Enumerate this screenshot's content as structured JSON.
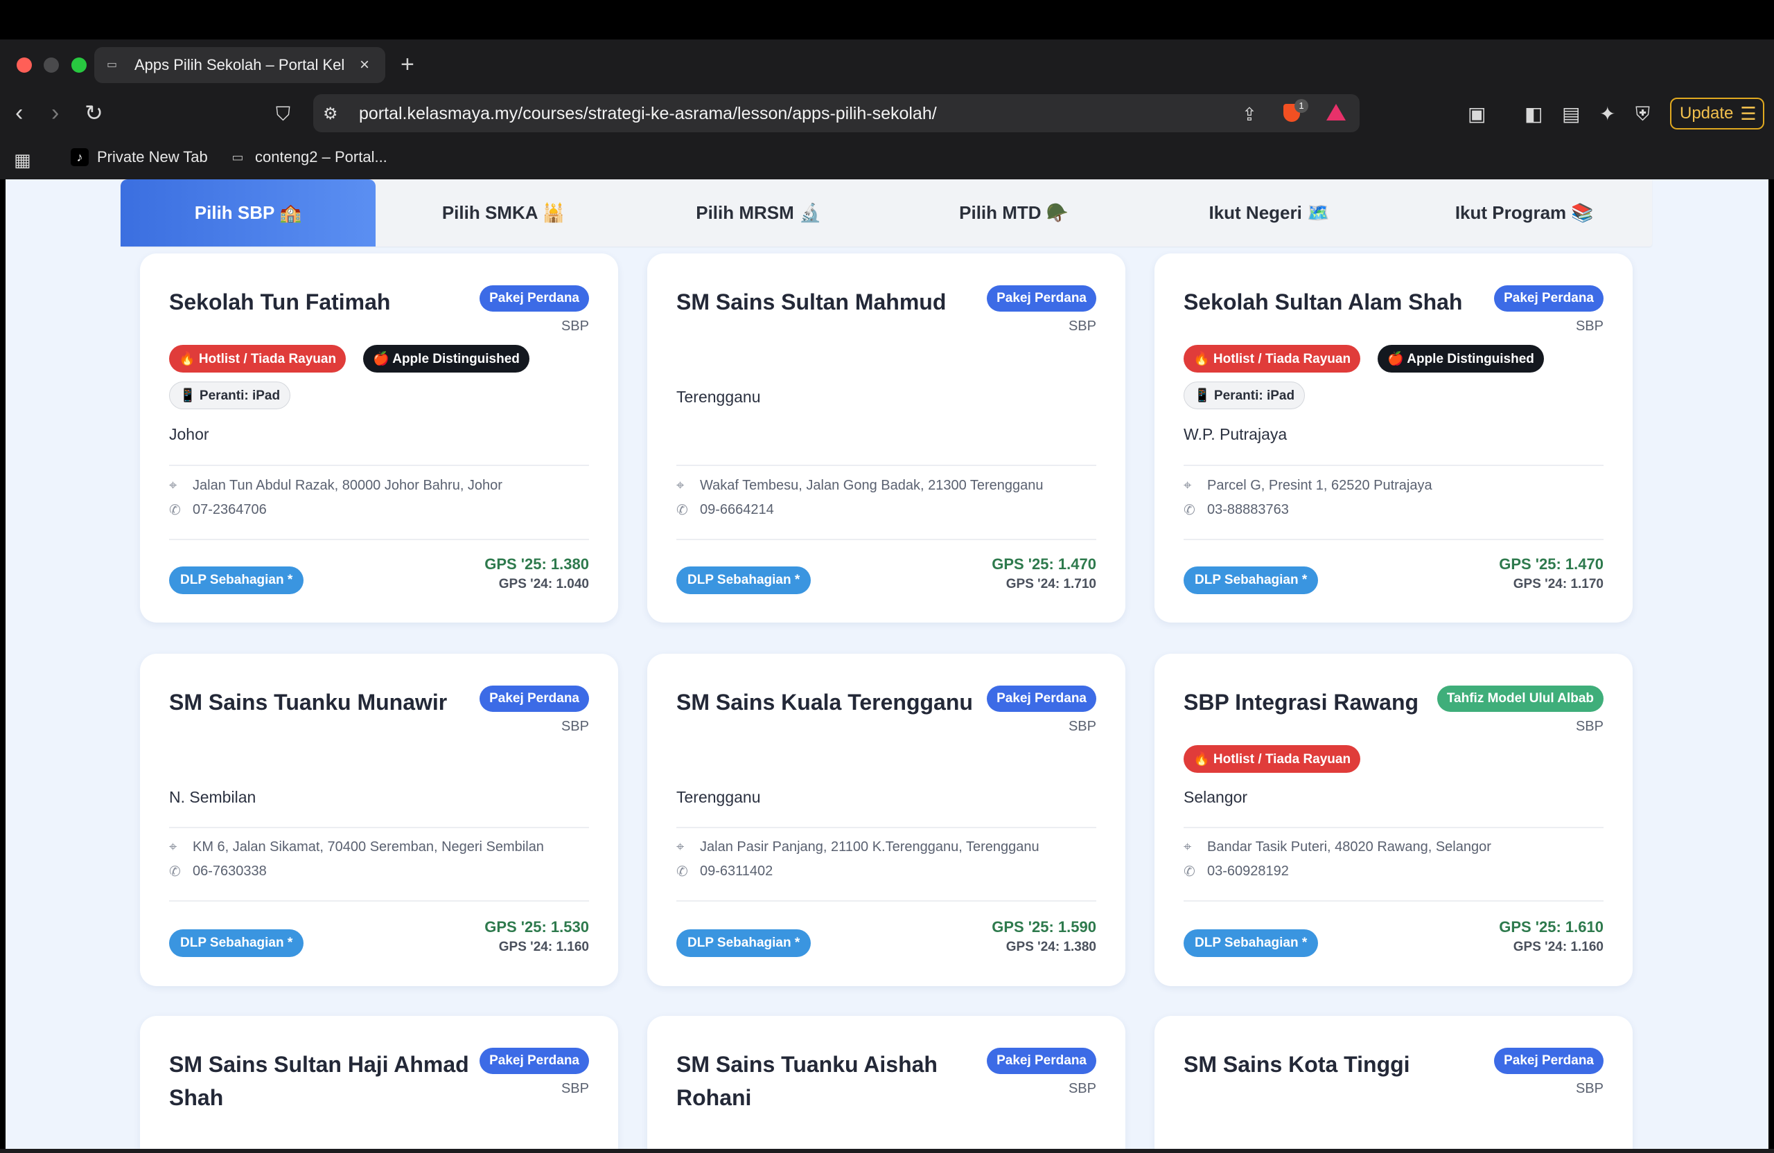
{
  "browser": {
    "tab_title": "Apps Pilih Sekolah – Portal Kel",
    "url": "portal.kelasmaya.my/courses/strategi-ke-asrama/lesson/apps-pilih-sekolah/",
    "update_label": "Update",
    "shield_count": "1",
    "bookmarks": [
      {
        "label": "Private New Tab",
        "icon": "tiktok-icon"
      },
      {
        "label": "conteng2 – Portal...",
        "icon": "site-icon"
      }
    ],
    "colors": {
      "update_accent": "#e0a920",
      "shield": "#f25022"
    }
  },
  "tabs": [
    {
      "label": "Pilih SBP 🏫",
      "active": true
    },
    {
      "label": "Pilih SMKA 🕌",
      "active": false
    },
    {
      "label": "Pilih MRSM 🔬",
      "active": false
    },
    {
      "label": "Pilih MTD 🪖",
      "active": false
    },
    {
      "label": "Ikut Negeri 🗺️",
      "active": false
    },
    {
      "label": "Ikut Program 📚",
      "active": false
    }
  ],
  "cards": [
    {
      "name": "Sekolah Tun Fatimah",
      "pakej": "Pakej Perdana",
      "type": "SBP",
      "tags": [
        "🔥 Hotlist / Tiada Rayuan",
        "🍎 Apple Distinguished",
        "📱 Peranti: iPad"
      ],
      "state": "Johor",
      "address": "Jalan Tun Abdul Razak, 80000 Johor Bahru, Johor",
      "phone": "07-2364706",
      "dlp": "DLP Sebahagian *",
      "gps25": "GPS '25: 1.380",
      "gps24": "GPS '24: 1.040"
    },
    {
      "name": "SM Sains Sultan Mahmud",
      "pakej": "Pakej Perdana",
      "type": "SBP",
      "tags": [],
      "state": "Terengganu",
      "address": "Wakaf Tembesu, Jalan Gong Badak, 21300 Terengganu",
      "phone": "09-6664214",
      "dlp": "DLP Sebahagian *",
      "gps25": "GPS '25: 1.470",
      "gps24": "GPS '24: 1.710"
    },
    {
      "name": "Sekolah Sultan Alam Shah",
      "pakej": "Pakej Perdana",
      "type": "SBP",
      "tags": [
        "🔥 Hotlist / Tiada Rayuan",
        "🍎 Apple Distinguished",
        "📱 Peranti: iPad"
      ],
      "state": "W.P. Putrajaya",
      "address": "Parcel G, Presint 1, 62520 Putrajaya",
      "phone": "03-88883763",
      "dlp": "DLP Sebahagian *",
      "gps25": "GPS '25: 1.470",
      "gps24": "GPS '24: 1.170"
    },
    {
      "name": "SM Sains Tuanku Munawir",
      "pakej": "Pakej Perdana",
      "type": "SBP",
      "tags": [],
      "state": "N. Sembilan",
      "address": "KM 6, Jalan Sikamat, 70400 Seremban, Negeri Sembilan",
      "phone": "06-7630338",
      "dlp": "DLP Sebahagian *",
      "gps25": "GPS '25: 1.530",
      "gps24": "GPS '24: 1.160"
    },
    {
      "name": "SM Sains Kuala Terengganu",
      "pakej": "Pakej Perdana",
      "type": "SBP",
      "tags": [],
      "state": "Terengganu",
      "address": "Jalan Pasir Panjang, 21100 K.Terengganu, Terengganu",
      "phone": "09-6311402",
      "dlp": "DLP Sebahagian *",
      "gps25": "GPS '25: 1.590",
      "gps24": "GPS '24: 1.380"
    },
    {
      "name": "SBP Integrasi Rawang",
      "pakej": "Tahfiz Model Ulul Albab",
      "type": "SBP",
      "tags": [
        "🔥 Hotlist / Tiada Rayuan"
      ],
      "state": "Selangor",
      "address": "Bandar Tasik Puteri, 48020 Rawang, Selangor",
      "phone": "03-60928192",
      "dlp": "DLP Sebahagian *",
      "gps25": "GPS '25: 1.610",
      "gps24": "GPS '24: 1.160"
    },
    {
      "name": "SM Sains Sultan Haji Ahmad Shah",
      "pakej": "Pakej Perdana",
      "type": "SBP"
    },
    {
      "name": "SM Sains Tuanku Aishah Rohani",
      "pakej": "Pakej Perdana",
      "type": "SBP"
    },
    {
      "name": "SM Sains Kota Tinggi",
      "pakej": "Pakej Perdana",
      "type": "SBP"
    }
  ],
  "colors": {
    "pakej_perdana": "#3c6be6",
    "pakej_tahfiz": "#3fae7a",
    "hotlist": "#e03c3a",
    "apple": "#14181f",
    "dlp": "#3a95e0",
    "gps_current": "#2e7a4d",
    "tab_active": "#3b6fe0"
  }
}
